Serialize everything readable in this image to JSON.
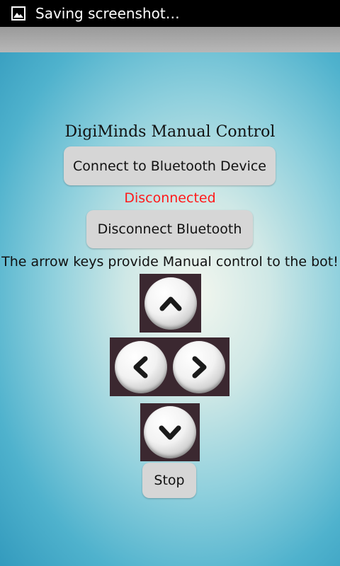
{
  "status_bar": {
    "notification_text": "Saving screenshot…",
    "icon": "image-icon"
  },
  "app": {
    "title": "DigiMinds Manual Control",
    "connect_button": "Connect to Bluetooth Device",
    "connection_status": "Disconnected",
    "disconnect_button": "Disconnect Bluetooth",
    "instructions": "The arrow keys provide Manual control to the bot!",
    "stop_button": "Stop",
    "arrows": {
      "up": "chevron-up-icon",
      "left": "chevron-left-icon",
      "right": "chevron-right-icon",
      "down": "chevron-down-icon"
    }
  },
  "colors": {
    "status_text": "#ff1a1a",
    "button_bg": "#d6d6d6"
  }
}
